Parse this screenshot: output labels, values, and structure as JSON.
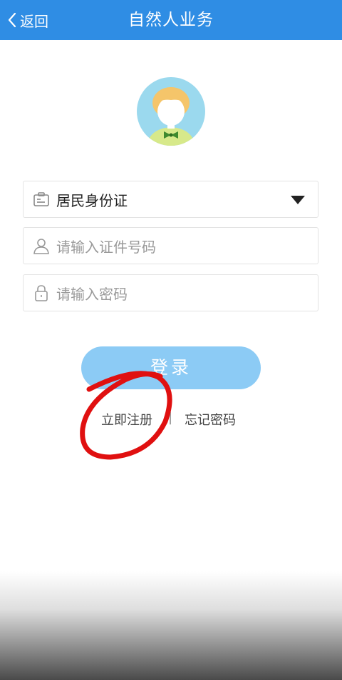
{
  "header": {
    "back_label": "返回",
    "title": "自然人业务"
  },
  "form": {
    "id_type_selected": "居民身份证",
    "id_number_placeholder": "请输入证件号码",
    "password_placeholder": "请输入密码"
  },
  "actions": {
    "login_label": "登录",
    "register_label": "立即注册",
    "separator": "|",
    "forgot_label": "忘记密码"
  },
  "colors": {
    "header_bg": "#2f8de4",
    "login_bg": "#8ccbf5",
    "annotation_red": "#e01010"
  },
  "icons": {
    "back": "chevron-left-icon",
    "avatar": "user-avatar-icon",
    "id_type": "id-card-icon",
    "id_number": "user-icon",
    "password": "lock-icon",
    "dropdown": "caret-down-icon"
  }
}
